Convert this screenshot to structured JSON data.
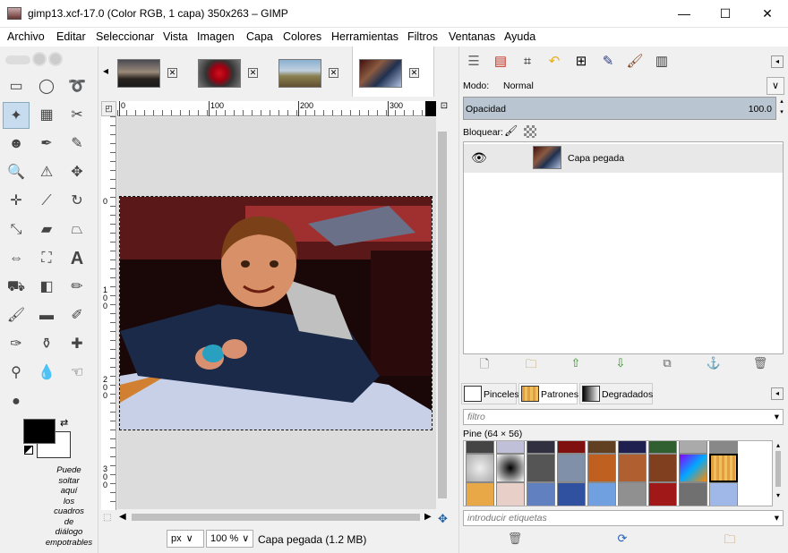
{
  "window": {
    "title": "gimp13.xcf-17.0 (Color RGB, 1 capa) 350x263 – GIMP",
    "minimize": "—",
    "maximize": "☐",
    "close": "✕"
  },
  "menu": [
    "Archivo",
    "Editar",
    "Seleccionar",
    "Vista",
    "Imagen",
    "Capa",
    "Colores",
    "Herramientas",
    "Filtros",
    "Ventanas",
    "Ayuda"
  ],
  "toolbox": {
    "drop_hint": [
      "Puede",
      "soltar",
      "aquí",
      "los",
      "cuadros",
      "de",
      "diálogo",
      "empotrables"
    ]
  },
  "image_tabs": {
    "scroll_left": "◂",
    "close_glyph": "✕"
  },
  "ruler": {
    "h_labels": [
      "0",
      "100",
      "200",
      "300"
    ],
    "v_labels": [
      "0",
      "1\n0\n0",
      "2\n0\n0",
      "3\n0\n0"
    ]
  },
  "status": {
    "unit": "px",
    "zoom": "100 %",
    "message": "Capa pegada (1.2 MB)"
  },
  "layers": {
    "mode_label": "Modo:",
    "mode_value": "Normal",
    "opacity_label": "Opacidad",
    "opacity_value": "100.0",
    "lock_label": "Bloquear:",
    "layer_name": "Capa pegada"
  },
  "bottom_dock": {
    "tabs": [
      "Pinceles",
      "Patrones",
      "Degradados"
    ],
    "filter_placeholder": "filtro",
    "pattern_name": "Pine (64 × 56)",
    "tags_placeholder": "introducir etiquetas"
  },
  "colors": {
    "fg": "#000000",
    "bg": "#ffffff",
    "accent": "#b9c6d2"
  }
}
